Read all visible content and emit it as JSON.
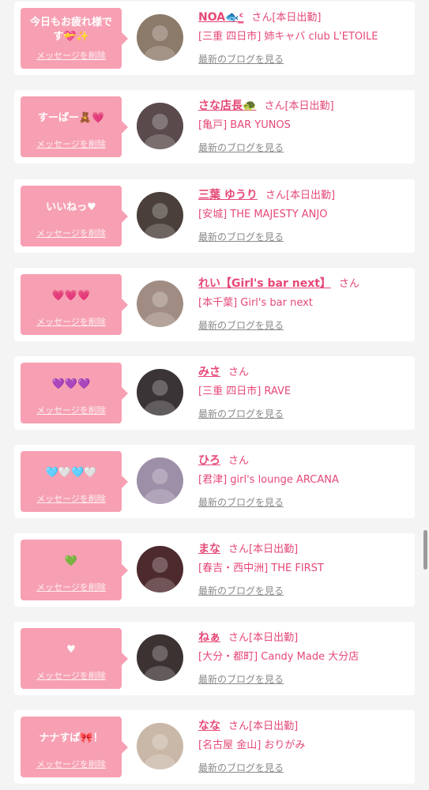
{
  "cards": [
    {
      "message": "今日もお疲れ様です💝✨",
      "delete_label": "メッセージを削除",
      "name": "NOA🐟ᶜ̲",
      "suffix": "さん[本日出勤]",
      "shop": "[三重 四日市] 姉キャバ club L'ETOILE",
      "blog_label": "最新のブログを見る",
      "avatar_color": "#8c7a6a"
    },
    {
      "message": "すーぱー🧸💗",
      "delete_label": "メッセージを削除",
      "name": "さな店長🐢",
      "suffix": "さん[本日出勤]",
      "shop": "[亀戸] BAR YUNOS",
      "blog_label": "最新のブログを見る",
      "avatar_color": "#5a4a4c"
    },
    {
      "message": "いいねっ♥",
      "delete_label": "メッセージを削除",
      "name": "三葉 ゆうり",
      "suffix": "さん[本日出勤]",
      "shop": "[安城] THE MAJESTY ANJO",
      "blog_label": "最新のブログを見る",
      "avatar_color": "#4a3f3a"
    },
    {
      "message": "💗💗💗",
      "delete_label": "メッセージを削除",
      "name": "れい【Girl's bar next】",
      "suffix": "さん",
      "shop": "[本千葉] Girl's bar next",
      "blog_label": "最新のブログを見る",
      "avatar_color": "#a08c82"
    },
    {
      "message": "💜💜💜",
      "delete_label": "メッセージを削除",
      "name": "みさ",
      "suffix": "さん",
      "shop": "[三重 四日市] RAVE",
      "blog_label": "最新のブログを見る",
      "avatar_color": "#3a3436"
    },
    {
      "message": "🩵🤍🩵🤍",
      "delete_label": "メッセージを削除",
      "name": "ひろ",
      "suffix": "さん",
      "shop": "[君津] girl's lounge ARCANA",
      "blog_label": "最新のブログを見る",
      "avatar_color": "#9d8fa8"
    },
    {
      "message": "💚",
      "delete_label": "メッセージを削除",
      "name": "まな",
      "suffix": "さん[本日出勤]",
      "shop": "[春吉・西中洲] THE FIRST",
      "blog_label": "最新のブログを見る",
      "avatar_color": "#4d2a2e"
    },
    {
      "message": "♥",
      "delete_label": "メッセージを削除",
      "name": "ねぁ",
      "suffix": "さん[本日出勤]",
      "shop": "[大分・都町] Candy Made 大分店",
      "blog_label": "最新のブログを見る",
      "avatar_color": "#3c3232"
    },
    {
      "message": "ナナすば🎀！",
      "delete_label": "メッセージを削除",
      "name": "なな",
      "suffix": "さん[本日出勤]",
      "shop": "[名古屋 金山] おりがみ",
      "blog_label": "最新のブログを見る",
      "avatar_color": "#c9b8a8"
    }
  ]
}
